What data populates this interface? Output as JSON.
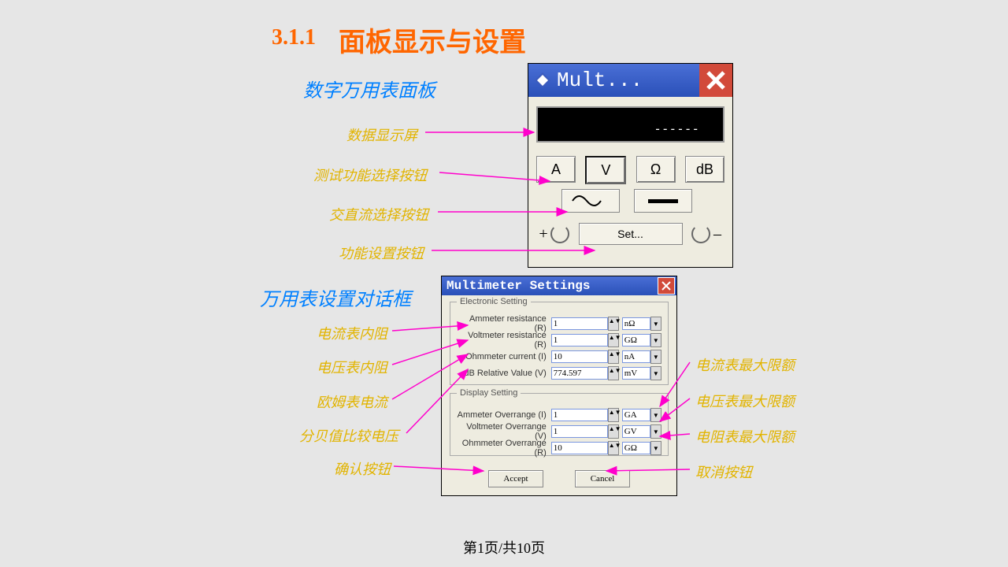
{
  "head": {
    "num": "3.1.1",
    "txt": "面板显示与设置"
  },
  "sub": {
    "panel": "数字万用表面板",
    "dialog": "万用表设置对话框"
  },
  "anno": {
    "lcd": "数据显示屏",
    "func": "测试功能选择按钮",
    "acdc": "交直流选择按钮",
    "set": "功能设置按钮",
    "ar": "电流表内阻",
    "vr": "电压表内阻",
    "oc": "欧姆表电流",
    "db": "分贝值比较电压",
    "ok": "确认按钮",
    "amax": "电流表最大限额",
    "vmax": "电压表最大限额",
    "rmax": "电阻表最大限额",
    "cancel": "取消按钮"
  },
  "mm": {
    "title": "Mult...",
    "lcd": "------",
    "btns": {
      "A": "A",
      "V": "V",
      "O": "Ω",
      "dB": "dB"
    },
    "set": "Set...",
    "plus": "+",
    "minus": "–"
  },
  "dlg": {
    "title": "Multimeter Settings",
    "g1": "Electronic Setting",
    "g2": "Display Setting",
    "rows": {
      "ar": {
        "l": "Ammeter resistance (R)",
        "v": "1",
        "u": "nΩ"
      },
      "vr": {
        "l": "Voltmeter resistance (R)",
        "v": "1",
        "u": "GΩ"
      },
      "oc": {
        "l": "Ohmmeter current (I)",
        "v": "10",
        "u": "nA"
      },
      "db": {
        "l": "dB Relative Value (V)",
        "v": "774.597",
        "u": "mV"
      },
      "ao": {
        "l": "Ammeter Overrange (I)",
        "v": "1",
        "u": "GA"
      },
      "vo": {
        "l": "Voltmeter Overrange (V)",
        "v": "1",
        "u": "GV"
      },
      "oo": {
        "l": "Ohmmeter Overrange (R)",
        "v": "10",
        "u": "GΩ"
      }
    },
    "accept": "Accept",
    "cancel": "Cancel"
  },
  "pager": "第1页/共10页"
}
